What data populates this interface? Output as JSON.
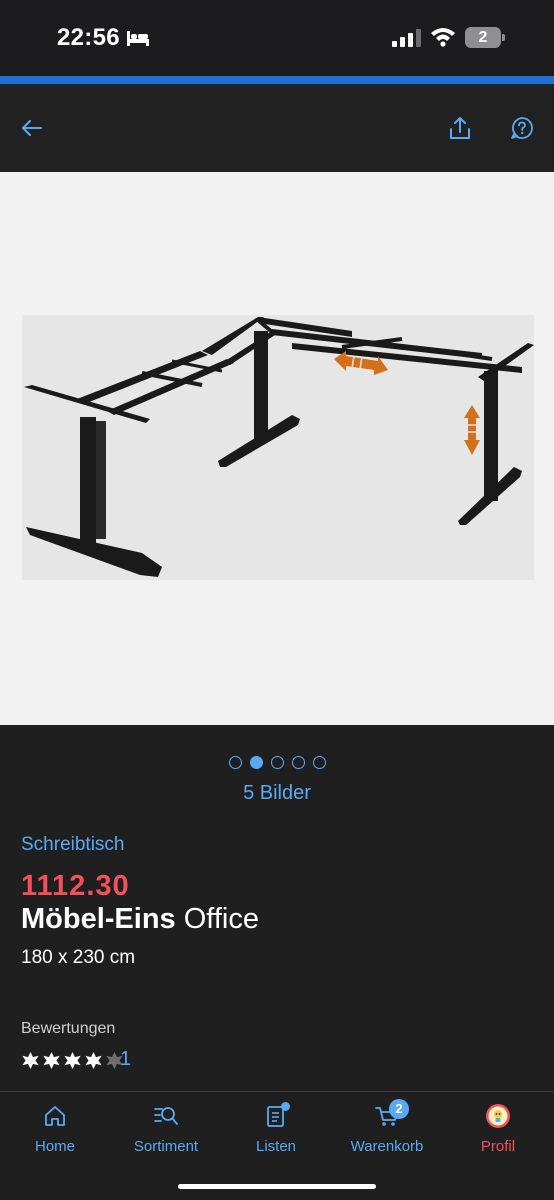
{
  "status": {
    "time": "22:56",
    "battery": "2"
  },
  "gallery": {
    "total_label": "5 Bilder",
    "dot_count": 5,
    "active_index": 1
  },
  "product": {
    "category": "Schreibtisch",
    "price": "1112.30",
    "brand": "Möbel-Eins",
    "name": "Office",
    "dimensions": "180 x 230 cm"
  },
  "reviews": {
    "label": "Bewertungen",
    "rating": 4,
    "max": 5,
    "count": "1"
  },
  "tabs": [
    {
      "label": "Home",
      "icon": "home-icon"
    },
    {
      "label": "Sortiment",
      "icon": "search-list-icon"
    },
    {
      "label": "Listen",
      "icon": "list-document-icon"
    },
    {
      "label": "Warenkorb",
      "icon": "cart-icon",
      "badge": "2"
    },
    {
      "label": "Profil",
      "icon": "avatar-icon"
    }
  ],
  "colors": {
    "accent": "#5aa9f5",
    "price": "#f4505a",
    "top_line": "#1d6fd1",
    "background": "#1f1f1f"
  }
}
